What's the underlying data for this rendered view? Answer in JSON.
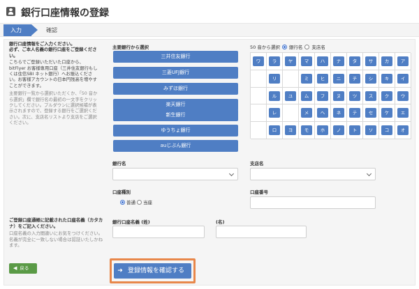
{
  "header": {
    "title": "銀行口座情報の登録"
  },
  "steps": {
    "current": "入力",
    "next": "確認"
  },
  "intro": {
    "bold1": "銀行口座情報をご入力ください。",
    "bold2": "必ず、ご本人名義の銀行口座をご登録ください。",
    "normal": "こちらでご登録いただいた口座から、bitFlyer お客様専用口座（三井住友銀行もしくは住信SBI ネット銀行）へお振込ください。お客様アカウントの日本円残高を増やすことができます。",
    "small": "主要銀行一覧から選択いただくか、「50 音から選択」欄で銀行名の最初の一文字をクリックしてください。プルダウンに選択候補が表示されますので、登録する銀行をご選択ください。次に、支店名リストより支店をご選択ください。"
  },
  "banks": {
    "heading": "主要銀行から選択",
    "items": [
      "三井住友銀行",
      "三菱UFJ銀行",
      "みずほ銀行",
      "楽天銀行",
      "新生銀行",
      "ゆうちょ銀行",
      "auじぶん銀行"
    ]
  },
  "kana": {
    "heading": "50 音から選択",
    "opt_bank": "銀行名",
    "opt_branch": "支店名",
    "rows": [
      [
        "ワ",
        "ラ",
        "ヤ",
        "マ",
        "ハ",
        "ナ",
        "タ",
        "サ",
        "カ",
        "ア"
      ],
      [
        "",
        "リ",
        "",
        "ミ",
        "ヒ",
        "ニ",
        "チ",
        "シ",
        "キ",
        "イ"
      ],
      [
        "",
        "ル",
        "ユ",
        "ム",
        "フ",
        "ヌ",
        "ツ",
        "ス",
        "ク",
        "ウ"
      ],
      [
        "",
        "レ",
        "",
        "メ",
        "ヘ",
        "ネ",
        "テ",
        "セ",
        "ケ",
        "エ"
      ],
      [
        "",
        "ロ",
        "ヨ",
        "モ",
        "ホ",
        "ノ",
        "ト",
        "ソ",
        "コ",
        "オ"
      ]
    ]
  },
  "form": {
    "bank_name_label": "銀行名",
    "branch_name_label": "支店名",
    "account_type_label": "口座種別",
    "account_type_normal": "普通",
    "account_type_current": "当座",
    "account_number_label": "口座番号",
    "holder_note_bold": "ご登録口座通帳に記載された口座名義（カタカナ）をご記入ください。",
    "holder_note_small": "口座名義の入力間違いにお気をつけください。名義が完全に一致しない場合は認証いたしかねます。",
    "last_name_label": "銀行口座名義 (姓)",
    "first_name_label": "(名)"
  },
  "actions": {
    "back": "戻る",
    "confirm": "登録情報を確認する"
  },
  "colors": {
    "primary": "#4f7ec4",
    "back": "#5a9a46",
    "highlight": "#e8874a"
  }
}
